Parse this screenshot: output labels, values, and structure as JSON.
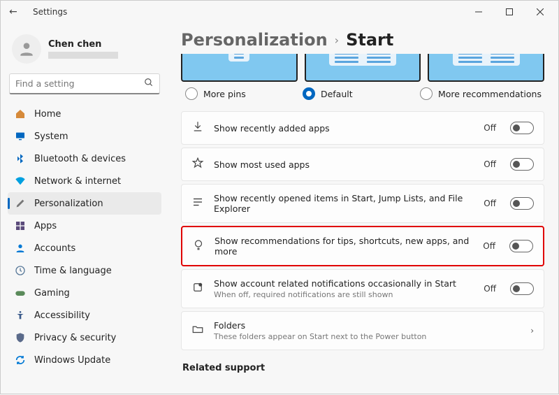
{
  "window": {
    "title": "Settings"
  },
  "user": {
    "name": "Chen chen"
  },
  "search": {
    "placeholder": "Find a setting"
  },
  "nav": {
    "items": [
      {
        "label": "Home"
      },
      {
        "label": "System"
      },
      {
        "label": "Bluetooth & devices"
      },
      {
        "label": "Network & internet"
      },
      {
        "label": "Personalization"
      },
      {
        "label": "Apps"
      },
      {
        "label": "Accounts"
      },
      {
        "label": "Time & language"
      },
      {
        "label": "Gaming"
      },
      {
        "label": "Accessibility"
      },
      {
        "label": "Privacy & security"
      },
      {
        "label": "Windows Update"
      }
    ]
  },
  "breadcrumb": {
    "parent": "Personalization",
    "current": "Start"
  },
  "layout_options": {
    "a": "More pins",
    "b": "Default",
    "c": "More recommendations",
    "selected": "b"
  },
  "rows": {
    "recent_apps": {
      "label": "Show recently added apps",
      "state": "Off"
    },
    "most_used": {
      "label": "Show most used apps",
      "state": "Off"
    },
    "recent_items": {
      "label": "Show recently opened items in Start, Jump Lists, and File Explorer",
      "state": "Off"
    },
    "recommend": {
      "label": "Show recommendations for tips, shortcuts, new apps, and more",
      "state": "Off"
    },
    "account_notif": {
      "label": "Show account related notifications occasionally in Start",
      "sub": "When off, required notifications are still shown",
      "state": "Off"
    },
    "folders": {
      "label": "Folders",
      "sub": "These folders appear on Start next to the Power button"
    }
  },
  "related": {
    "heading": "Related support"
  }
}
